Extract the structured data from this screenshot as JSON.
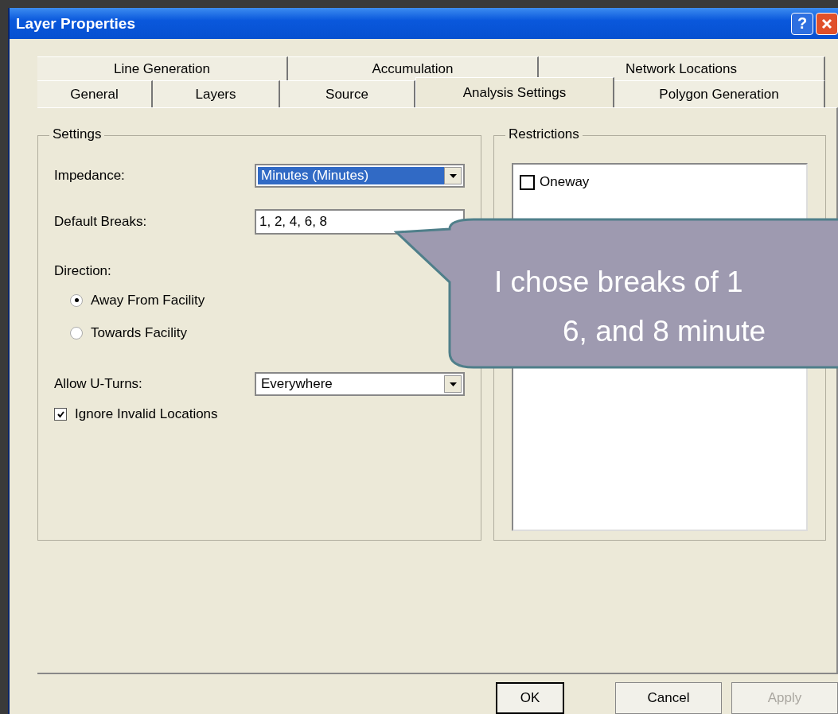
{
  "window": {
    "title": "Layer Properties",
    "help": "?"
  },
  "tabs": {
    "back_row": [
      {
        "label": "Line Generation",
        "selected": false
      },
      {
        "label": "Accumulation",
        "selected": false
      },
      {
        "label": "Network Locations",
        "selected": false
      }
    ],
    "front_row": [
      {
        "label": "General",
        "selected": false
      },
      {
        "label": "Layers",
        "selected": false
      },
      {
        "label": "Source",
        "selected": false
      },
      {
        "label": "Analysis Settings",
        "selected": true
      },
      {
        "label": "Polygon Generation",
        "selected": false
      }
    ]
  },
  "settings": {
    "title": "Settings",
    "impedance": {
      "label": "Impedance:",
      "value": "Minutes (Minutes)",
      "highlighted": true
    },
    "default_breaks": {
      "label": "Default Breaks:",
      "value": "1, 2, 4, 6, 8"
    },
    "direction": {
      "label": "Direction:",
      "options": [
        {
          "label": "Away From Facility",
          "selected": true
        },
        {
          "label": "Towards Facility",
          "selected": false
        }
      ]
    },
    "u_turns": {
      "label": "Allow U-Turns:",
      "value": "Everywhere",
      "highlighted": false
    },
    "ignore_invalid": {
      "label": "Ignore Invalid Locations",
      "checked": true
    }
  },
  "restrictions": {
    "title": "Restrictions",
    "items": [
      {
        "label": "Oneway",
        "checked": false
      }
    ]
  },
  "buttons": [
    {
      "label": "OK",
      "default": true,
      "disabled": false
    },
    {
      "label": "Cancel",
      "default": false,
      "disabled": false
    },
    {
      "label": "Apply",
      "default": false,
      "disabled": true
    }
  ],
  "callout": {
    "lines": [
      "I chose breaks of 1",
      "6, and 8 minute"
    ]
  }
}
